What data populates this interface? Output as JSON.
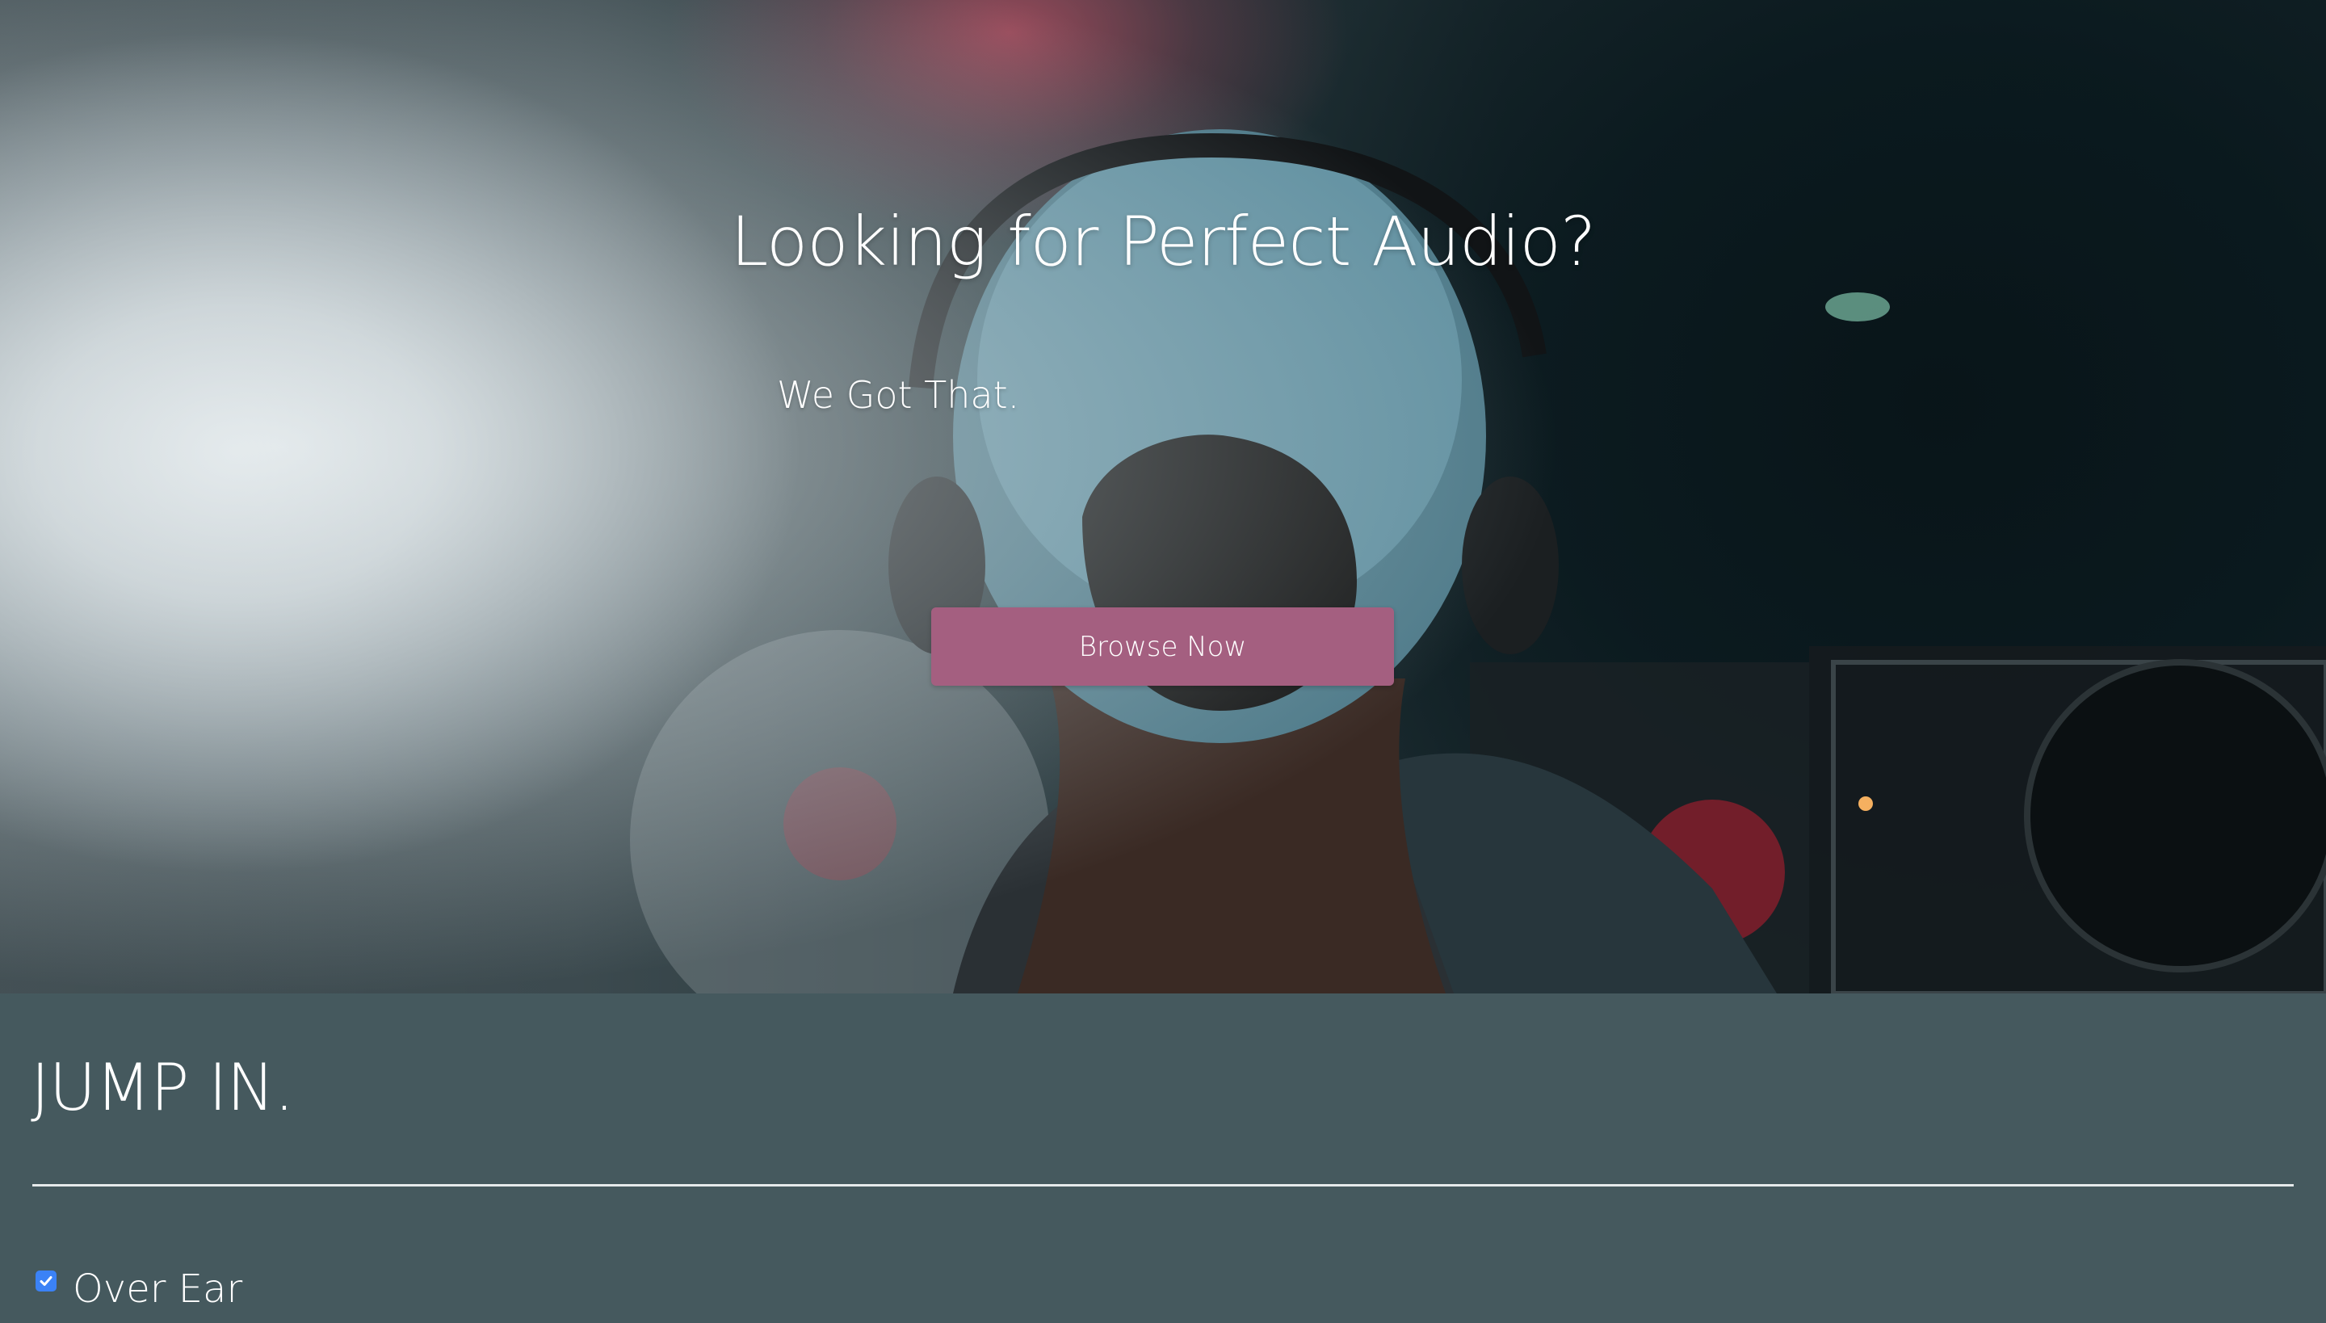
{
  "hero": {
    "title": "Looking for Perfect Audio?",
    "subtitle": "We Got That.",
    "cta_label": "Browse Now",
    "cta_color": "#a45f80",
    "background_image": "dj-with-headphones-photo"
  },
  "jump_section": {
    "title": "JUMP IN.",
    "background_color": "#45595e",
    "filters": [
      {
        "label": "Over Ear",
        "checked": true
      }
    ]
  }
}
